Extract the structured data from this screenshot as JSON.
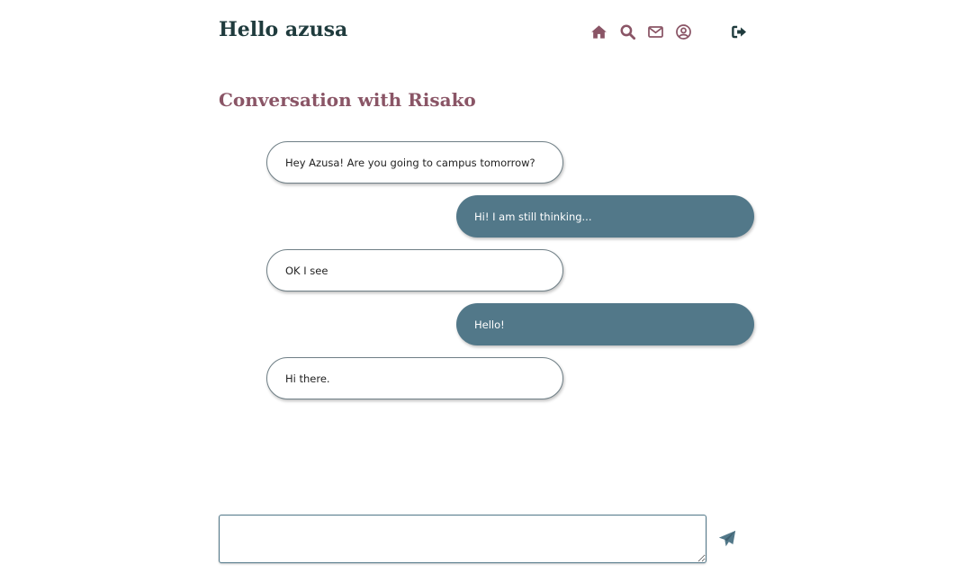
{
  "header": {
    "greeting": "Hello azusa",
    "nav": {
      "home_icon": "home-icon",
      "search_icon": "search-icon",
      "mail_icon": "mail-icon",
      "profile_icon": "user-circle-icon",
      "logout_icon": "sign-out-icon"
    }
  },
  "conversation": {
    "title": "Conversation with Risako",
    "messages": [
      {
        "from": "other",
        "text": "Hey Azusa! Are you going to campus tomorrow?"
      },
      {
        "from": "me",
        "text": "Hi! I am still thinking..."
      },
      {
        "from": "other",
        "text": "OK I see"
      },
      {
        "from": "me",
        "text": "Hello!"
      },
      {
        "from": "other",
        "text": "Hi there."
      }
    ]
  },
  "composer": {
    "value": "",
    "placeholder": "",
    "send_icon": "paper-plane-icon"
  },
  "colors": {
    "heading": "#1f3b3d",
    "accent": "#8a5566",
    "outgoing_bubble": "#527889",
    "send_icon": "#527889",
    "logout_icon": "#1f3b3d"
  }
}
